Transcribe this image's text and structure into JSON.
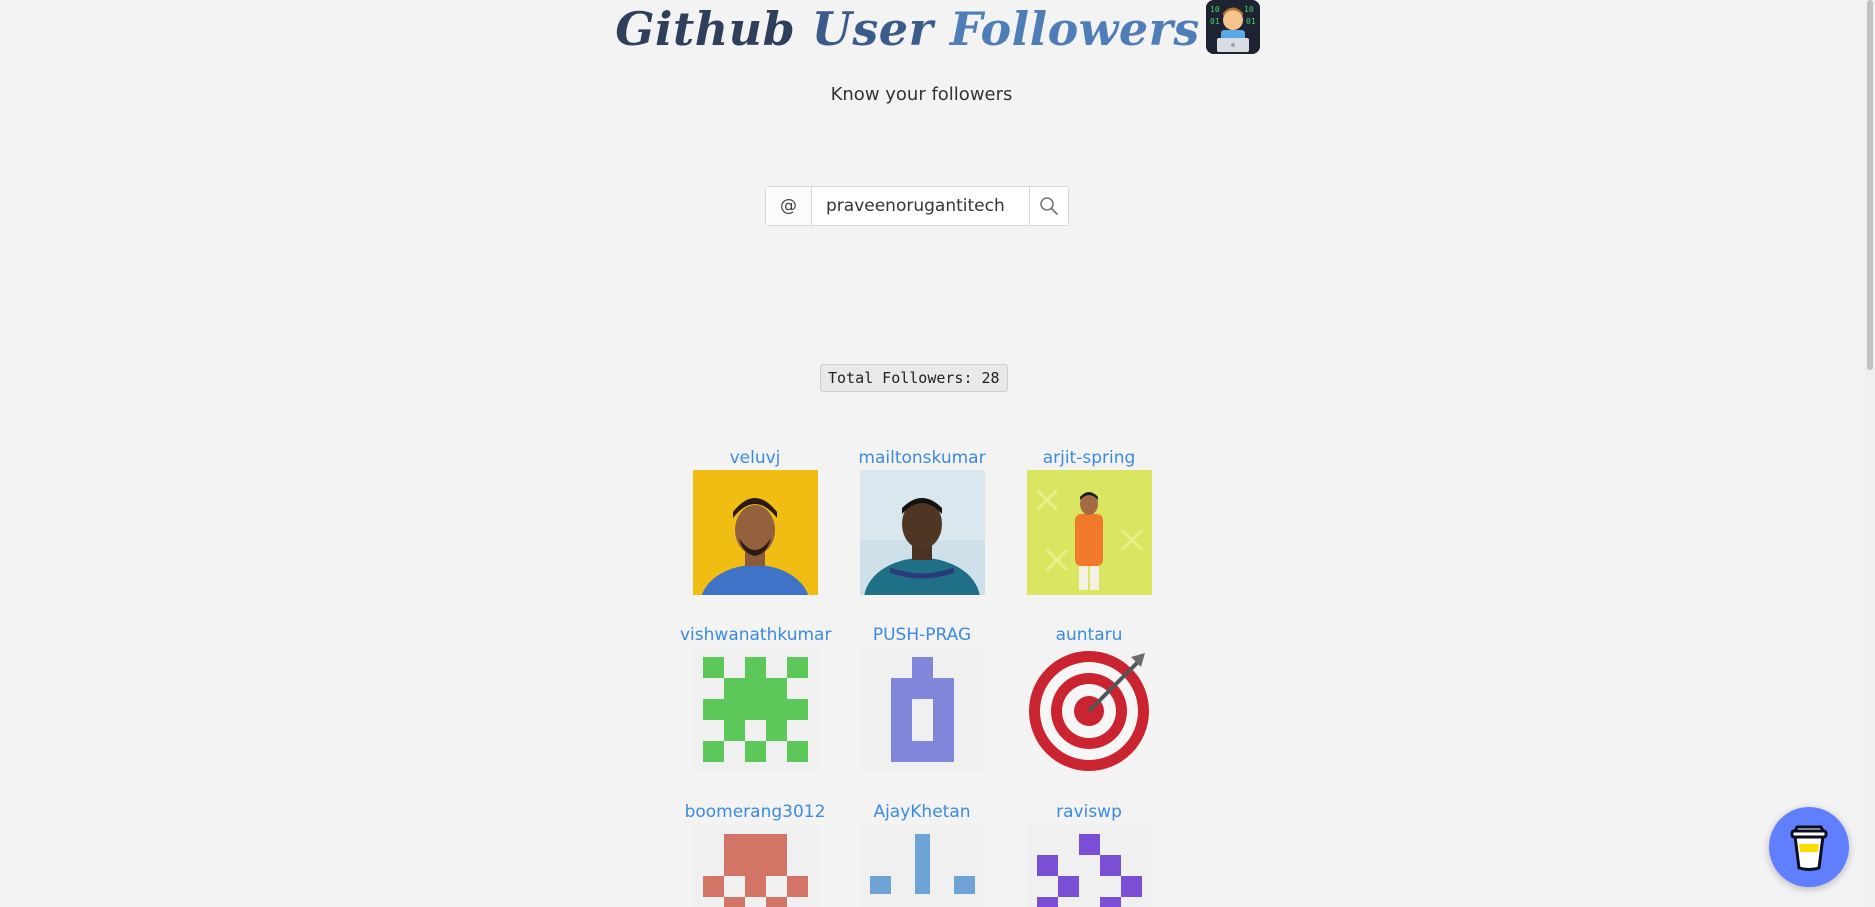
{
  "header": {
    "title_word1": "Github",
    "title_word2": "User",
    "title_word3": "Followers",
    "emoji_icon": "technologist-emoji-icon",
    "subtitle": "Know your followers"
  },
  "search": {
    "prefix": "@",
    "value": "praveenorugantitech",
    "icon": "search-icon"
  },
  "summary": {
    "total_followers_text": "Total Followers: 28"
  },
  "followers": [
    {
      "login": "veluvj",
      "avatar": "photo"
    },
    {
      "login": "mailtonskumar",
      "avatar": "photo"
    },
    {
      "login": "arjit-spring",
      "avatar": "photo"
    },
    {
      "login": "vishwanathkumar",
      "avatar": "identicon",
      "color": "#5cc85a"
    },
    {
      "login": "PUSH-PRAG",
      "avatar": "identicon",
      "color": "#8086d9"
    },
    {
      "login": "auntaru",
      "avatar": "target-emoji"
    },
    {
      "login": "boomerang3012",
      "avatar": "identicon",
      "color": "#d27566"
    },
    {
      "login": "AjayKhetan",
      "avatar": "identicon",
      "color": "#6ea3d6"
    },
    {
      "login": "raviswp",
      "avatar": "identicon",
      "color": "#7a4fd6"
    }
  ],
  "floating": {
    "coffee_icon": "coffee-cup-icon"
  }
}
